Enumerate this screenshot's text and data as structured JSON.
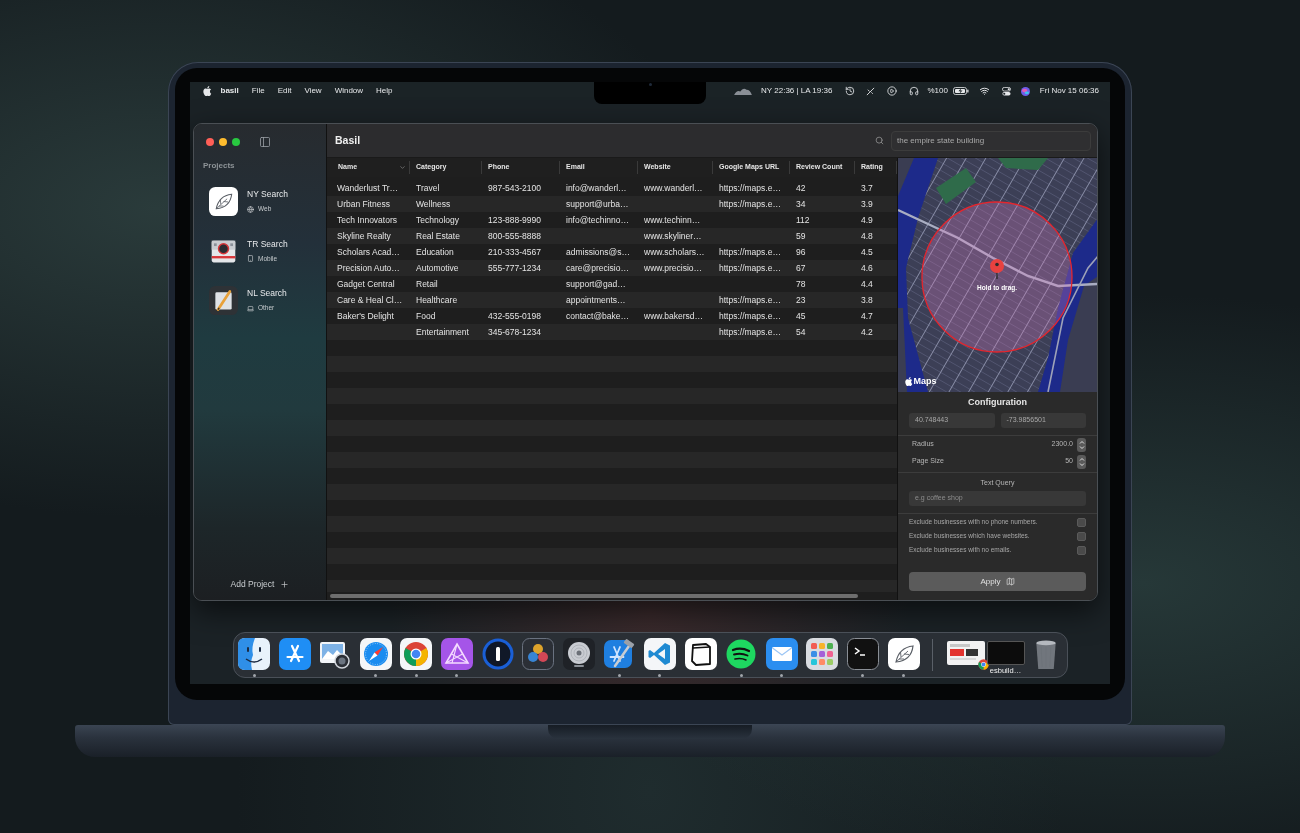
{
  "menu_bar": {
    "app_name": "basil",
    "menus": [
      "File",
      "Edit",
      "View",
      "Window",
      "Help"
    ],
    "world_clock": "NY 22:36 | LA 19:36",
    "battery": "%100",
    "datetime": "Fri Nov 15 06:36"
  },
  "window": {
    "title": "Basil"
  },
  "sidebar": {
    "heading": "Projects",
    "projects": [
      {
        "kind": "web",
        "name": "NY Search",
        "platform": "Web"
      },
      {
        "kind": "mobile",
        "name": "TR Search",
        "platform": "Mobile"
      },
      {
        "kind": "other",
        "name": "NL Search",
        "platform": "Other"
      }
    ],
    "add_button": "Add Project"
  },
  "search": {
    "value": "the empire state building"
  },
  "table": {
    "columns": [
      {
        "label": "Name",
        "sorted": true
      },
      {
        "label": "Category",
        "sorted": false
      },
      {
        "label": "Phone",
        "sorted": false
      },
      {
        "label": "Email",
        "sorted": false
      },
      {
        "label": "Website",
        "sorted": false
      },
      {
        "label": "Google Maps URL",
        "sorted": false
      },
      {
        "label": "Review Count",
        "sorted": false
      },
      {
        "label": "Rating",
        "sorted": false
      }
    ],
    "rows": [
      {
        "name": "Wanderlust Tr…",
        "category": "Travel",
        "phone": "987-543-2100",
        "email": "info@wanderl…",
        "website": "www.wanderl…",
        "maps_url": "https://maps.e…",
        "review_count": "42",
        "rating": "3.7"
      },
      {
        "name": "Urban Fitness",
        "category": "Wellness",
        "email": "support@urba…",
        "maps_url": "https://maps.e…",
        "review_count": "34",
        "rating": "3.9"
      },
      {
        "name": "Tech Innovators",
        "category": "Technology",
        "phone": "123-888-9990",
        "email": "info@techinno…",
        "website": "www.techinn…",
        "review_count": "112",
        "rating": "4.9"
      },
      {
        "name": "Skyline Realty",
        "category": "Real Estate",
        "phone": "800-555-8888",
        "website": "www.skyliner…",
        "review_count": "59",
        "rating": "4.8"
      },
      {
        "name": "Scholars Acad…",
        "category": "Education",
        "phone": "210-333-4567",
        "email": "admissions@s…",
        "website": "www.scholars…",
        "maps_url": "https://maps.e…",
        "review_count": "96",
        "rating": "4.5"
      },
      {
        "name": "Precision Auto…",
        "category": "Automotive",
        "phone": "555-777-1234",
        "email": "care@precisio…",
        "website": "www.precisio…",
        "maps_url": "https://maps.e…",
        "review_count": "67",
        "rating": "4.6"
      },
      {
        "name": "Gadget Central",
        "category": "Retail",
        "email": "support@gad…",
        "review_count": "78",
        "rating": "4.4"
      },
      {
        "name": "Care & Heal Cl…",
        "category": "Healthcare",
        "email": "appointments…",
        "maps_url": "https://maps.e…",
        "review_count": "23",
        "rating": "3.8"
      },
      {
        "name": "Baker's Delight",
        "category": "Food",
        "phone": "432-555-0198",
        "email": "contact@bake…",
        "website": "www.bakersd…",
        "maps_url": "https://maps.e…",
        "review_count": "45",
        "rating": "4.7"
      },
      {
        "category": "Entertainment",
        "phone": "345-678-1234",
        "maps_url": "https://maps.e…",
        "review_count": "54",
        "rating": "4.2"
      }
    ]
  },
  "map": {
    "pin_label": "Hold to drag.",
    "attribution": "Maps"
  },
  "configuration": {
    "title": "Configuration",
    "latitude": "40.748443",
    "longitude": "-73.9856501",
    "steppers": [
      {
        "label": "Radius",
        "value": "2300.0"
      },
      {
        "label": "Page Size",
        "value": "50"
      }
    ],
    "text_query": {
      "label": "Text Query",
      "placeholder": "e.g coffee shop"
    },
    "filters": [
      {
        "label": "Exclude businesses with no phone numbers.",
        "checked": false
      },
      {
        "label": "Exclude businesses which have websites.",
        "checked": false
      },
      {
        "label": "Exclude businesses with no emails.",
        "checked": false
      }
    ],
    "apply_button": "Apply"
  },
  "dock": {
    "apps": [
      {
        "kind": "face",
        "running": true
      },
      {
        "kind": "a-lines",
        "running": false
      },
      {
        "kind": "photo",
        "running": false
      },
      {
        "kind": "compass",
        "running": true
      },
      {
        "kind": "ring-ball",
        "running": true
      },
      {
        "kind": "prism",
        "running": true
      },
      {
        "kind": "key-ring",
        "running": false
      },
      {
        "kind": "circles",
        "running": false
      },
      {
        "kind": "disc",
        "running": false
      },
      {
        "kind": "hammer",
        "running": true
      },
      {
        "kind": "ribbon",
        "running": true
      },
      {
        "kind": "cube",
        "running": false
      },
      {
        "kind": "arcs",
        "running": true
      },
      {
        "kind": "envelope",
        "running": true
      },
      {
        "kind": "grid",
        "running": false
      },
      {
        "kind": "prompt",
        "running": true
      },
      {
        "kind": "leaf",
        "running": true
      }
    ],
    "windows": [
      {
        "kind": "browser"
      },
      {
        "kind": "terminal",
        "label": "esbuild…"
      }
    ]
  }
}
